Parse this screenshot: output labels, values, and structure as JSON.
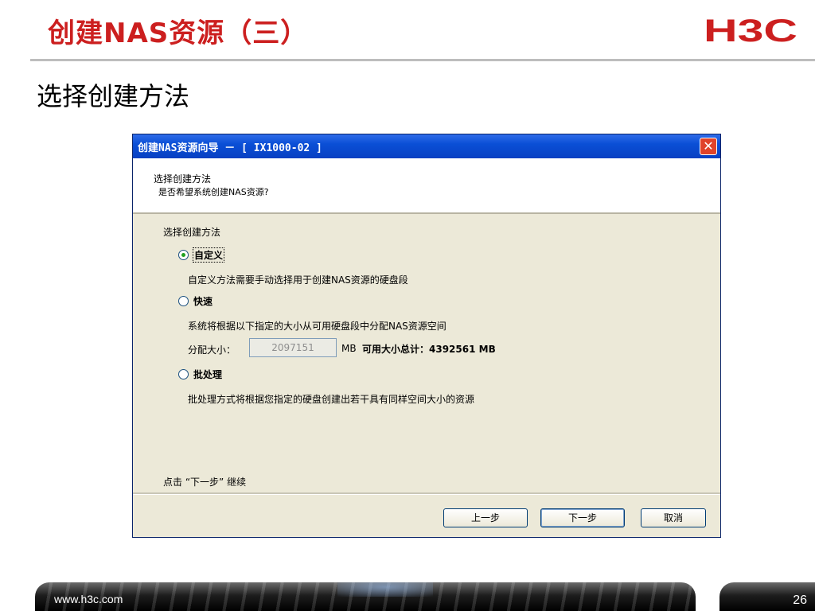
{
  "slide": {
    "title": "创建NAS资源（三）",
    "logo_text": "H3C",
    "heading": "选择创建方法",
    "footer_url": "www.h3c.com",
    "page_number": "26",
    "accent_color": "#cc1f1f"
  },
  "dialog": {
    "title": "创建NAS资源向导 － [ IX1000-02 ]",
    "header": {
      "title": "选择创建方法",
      "subtitle": "是否希望系统创建NAS资源?"
    },
    "group_label": "选择创建方法",
    "options": [
      {
        "label": "自定义",
        "selected": true,
        "description": "自定义方法需要手动选择用于创建NAS资源的硬盘段"
      },
      {
        "label": "快速",
        "selected": false,
        "description": "系统将根据以下指定的大小从可用硬盘段中分配NAS资源空间"
      },
      {
        "label": "批处理",
        "selected": false,
        "description": "批处理方式将根据您指定的硬盘创建出若干具有同样空间大小的资源"
      }
    ],
    "allocation": {
      "label": "分配大小：",
      "value": "2097151",
      "unit": "MB",
      "total": "可用大小总计：4392561 MB"
    },
    "hint": "点击 “下一步” 继续",
    "buttons": {
      "back": "上一步",
      "next": "下一步",
      "cancel": "取消"
    },
    "close_icon": "close-icon",
    "close_glyph": "✕"
  }
}
